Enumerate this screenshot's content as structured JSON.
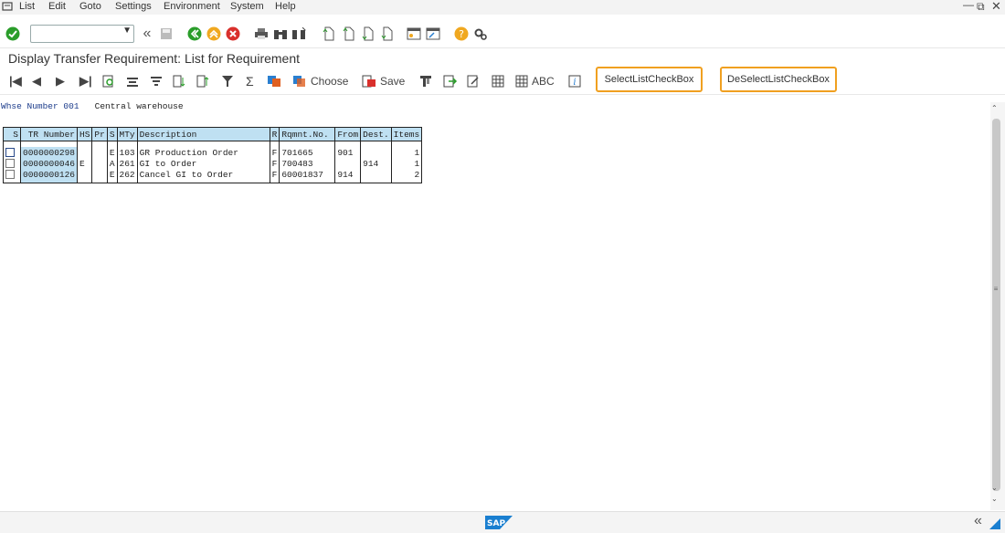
{
  "menu": {
    "items": [
      {
        "label": "List"
      },
      {
        "label": "Edit"
      },
      {
        "label": "Goto"
      },
      {
        "label": "Settings"
      },
      {
        "label": "Environment"
      },
      {
        "label": "System"
      },
      {
        "label": "Help"
      }
    ]
  },
  "title": "Display Transfer Requirement: List for Requirement",
  "toolbar2": {
    "choose_label": "Choose",
    "save_label": "Save",
    "abc_label": "ABC",
    "select_checkbox_label": "SelectListCheckBox",
    "deselect_checkbox_label": "DeSelectListCheckBox"
  },
  "header": {
    "whse_label": "Whse Number 001",
    "whse_name": "Central warehouse"
  },
  "table": {
    "columns": [
      "S",
      "TR Number",
      "HS",
      "Pr",
      "S",
      "MTy",
      "Description",
      "R",
      "Rqmnt.No.",
      "From",
      "Dest.",
      "Items"
    ],
    "rows": [
      {
        "tr": "0000000298",
        "hs": "",
        "pr": "",
        "s": "E",
        "mty": "103",
        "desc": "GR Production Order",
        "r": "F",
        "rqmnt": "701665",
        "from": "901",
        "dest": "",
        "items": "1"
      },
      {
        "tr": "0000000046",
        "hs": "E",
        "pr": "",
        "s": "A",
        "mty": "261",
        "desc": "GI to Order",
        "r": "F",
        "rqmnt": "700483",
        "from": "",
        "dest": "914",
        "items": "1"
      },
      {
        "tr": "0000000126",
        "hs": "",
        "pr": "",
        "s": "E",
        "mty": "262",
        "desc": "Cancel GI to Order",
        "r": "F",
        "rqmnt": "60001837",
        "from": "914",
        "dest": "",
        "items": "2"
      }
    ]
  },
  "status": {
    "logo": "SAP"
  },
  "colors": {
    "accent_orange": "#f0a020",
    "header_blue": "#bfe0f2",
    "green": "#2a9d2a",
    "red": "#d9302c",
    "yellow": "#f0a820"
  }
}
